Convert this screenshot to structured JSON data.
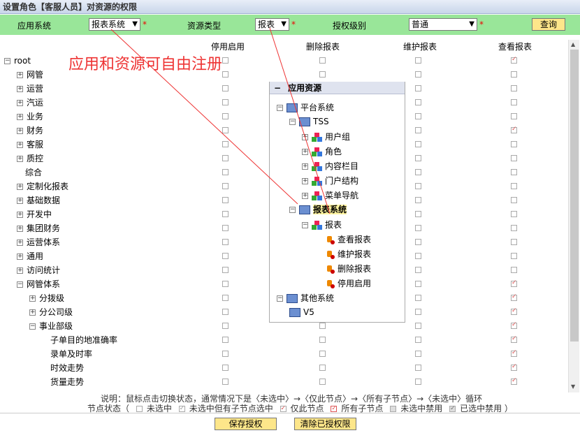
{
  "window_title": "设置角色【客服人员】对资源的权限",
  "filters": {
    "app_label": "应用系统",
    "app_value": "报表系统",
    "res_label": "资源类型",
    "res_value": "报表",
    "level_label": "授权级别",
    "level_value": "普通",
    "required_mark": "*",
    "query_label": "查询"
  },
  "columns": [
    "停用启用",
    "删除报表",
    "维护报表",
    "查看报表"
  ],
  "annotation": "应用和资源可自由注册",
  "tree": [
    {
      "label": "root",
      "pm": "⊟"
    },
    {
      "label": "网管",
      "pm": "+"
    },
    {
      "label": "运营",
      "pm": "+"
    },
    {
      "label": "汽运",
      "pm": "+"
    },
    {
      "label": "业务",
      "pm": "+"
    },
    {
      "label": "财务",
      "pm": "+"
    },
    {
      "label": "客服",
      "pm": "+"
    },
    {
      "label": "质控",
      "pm": "+"
    },
    {
      "label": "综合",
      "pm": ""
    },
    {
      "label": "定制化报表",
      "pm": "+"
    },
    {
      "label": "基础数据",
      "pm": "+"
    },
    {
      "label": "开发中",
      "pm": "+"
    },
    {
      "label": "集团财务",
      "pm": "+"
    },
    {
      "label": "运营体系",
      "pm": "+"
    },
    {
      "label": "通用",
      "pm": "+"
    },
    {
      "label": "访问统计",
      "pm": "+"
    },
    {
      "label": "网管体系",
      "pm": "-"
    },
    {
      "label": "分拨级",
      "pm": "+"
    },
    {
      "label": "分公司级",
      "pm": "+"
    },
    {
      "label": "事业部级",
      "pm": "-"
    },
    {
      "label": "子单目的地准确率",
      "pm": ""
    },
    {
      "label": "录单及时率",
      "pm": ""
    },
    {
      "label": "时效走势",
      "pm": ""
    },
    {
      "label": "货量走势",
      "pm": ""
    }
  ],
  "checked_view": [
    0,
    5,
    16,
    17,
    18,
    19,
    20,
    21,
    22,
    23
  ],
  "popup": {
    "title": "应用资源",
    "nodes": [
      {
        "label": "平台系统"
      },
      {
        "label": "TSS"
      },
      {
        "label": "用户组"
      },
      {
        "label": "角色"
      },
      {
        "label": "内容栏目"
      },
      {
        "label": "门户结构"
      },
      {
        "label": "菜单导航"
      },
      {
        "label": "报表系统"
      },
      {
        "label": "报表"
      },
      {
        "label": "查看报表"
      },
      {
        "label": "维护报表"
      },
      {
        "label": "删除报表"
      },
      {
        "label": "停用启用"
      },
      {
        "label": "其他系统"
      },
      {
        "label": "V5"
      }
    ]
  },
  "legend": {
    "line1": "说明：鼠标点击切换状态，通常情况下是〈未选中〉→〈仅此节点〉→〈所有子节点〉→〈未选中〉循环",
    "prefix": "节点状态（",
    "s1": "未选中",
    "s2": "未选中但有子节点选中",
    "s3": "仅此节点",
    "s4": "所有子节点",
    "s5": "未选中禁用",
    "s6": "已选中禁用",
    "suffix": "）"
  },
  "buttons": {
    "save": "保存授权",
    "clear": "清除已授权限"
  }
}
